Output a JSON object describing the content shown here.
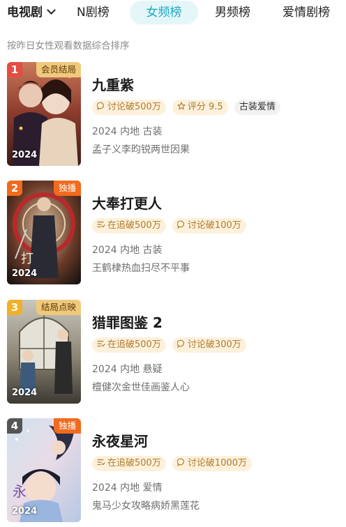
{
  "tabs": {
    "genre_label": "电视剧",
    "items": [
      "N剧榜",
      "女频榜",
      "男频榜",
      "爱情剧榜"
    ],
    "active": "女频榜"
  },
  "subtitle": "按昨日女性观看数据综合排序",
  "colors": {
    "accent": "#1aa8c4",
    "tag_bg": "#fdf1dc",
    "tag_text": "#b07a2c",
    "rank_1": "#e54d42",
    "rank_2": "#f26a1d",
    "rank_3": "#f2b02a",
    "rank_4": "#555555"
  },
  "items": [
    {
      "rank": "1",
      "badge": "会员结局",
      "badge_style": "gold",
      "poster_year": "2024",
      "title": "九重紫",
      "tags": [
        {
          "icon": "chat-bubble-icon",
          "text": "讨论破500万"
        },
        {
          "icon": "star-icon",
          "text": "评分 9.5"
        },
        {
          "icon": "",
          "text": "古装爱情"
        }
      ],
      "meta": "2024 内地 古装",
      "desc": "孟子义李昀锐两世因果"
    },
    {
      "rank": "2",
      "badge": "独播",
      "badge_style": "orange",
      "poster_year": "2024",
      "title": "大奉打更人",
      "tags": [
        {
          "icon": "chase-list-icon",
          "text": "在追破500万"
        },
        {
          "icon": "chat-bubble-icon",
          "text": "讨论破100万"
        }
      ],
      "meta": "2024 内地 古装",
      "desc": "王鹤棣热血扫尽不平事"
    },
    {
      "rank": "3",
      "badge": "结局点映",
      "badge_style": "gold",
      "poster_year": "2024",
      "title": "猎罪图鉴 2",
      "tags": [
        {
          "icon": "chase-list-icon",
          "text": "在追破500万"
        },
        {
          "icon": "chat-bubble-icon",
          "text": "讨论破300万"
        }
      ],
      "meta": "2024 内地 悬疑",
      "desc": "檀健次金世佳画鉴人心"
    },
    {
      "rank": "4",
      "badge": "独播",
      "badge_style": "orange",
      "poster_year": "2024",
      "title": "永夜星河",
      "tags": [
        {
          "icon": "chase-list-icon",
          "text": "在追破500万"
        },
        {
          "icon": "chat-bubble-icon",
          "text": "讨论破1000万"
        }
      ],
      "meta": "2024 内地 爱情",
      "desc": "鬼马少女攻略病娇黑莲花"
    }
  ]
}
